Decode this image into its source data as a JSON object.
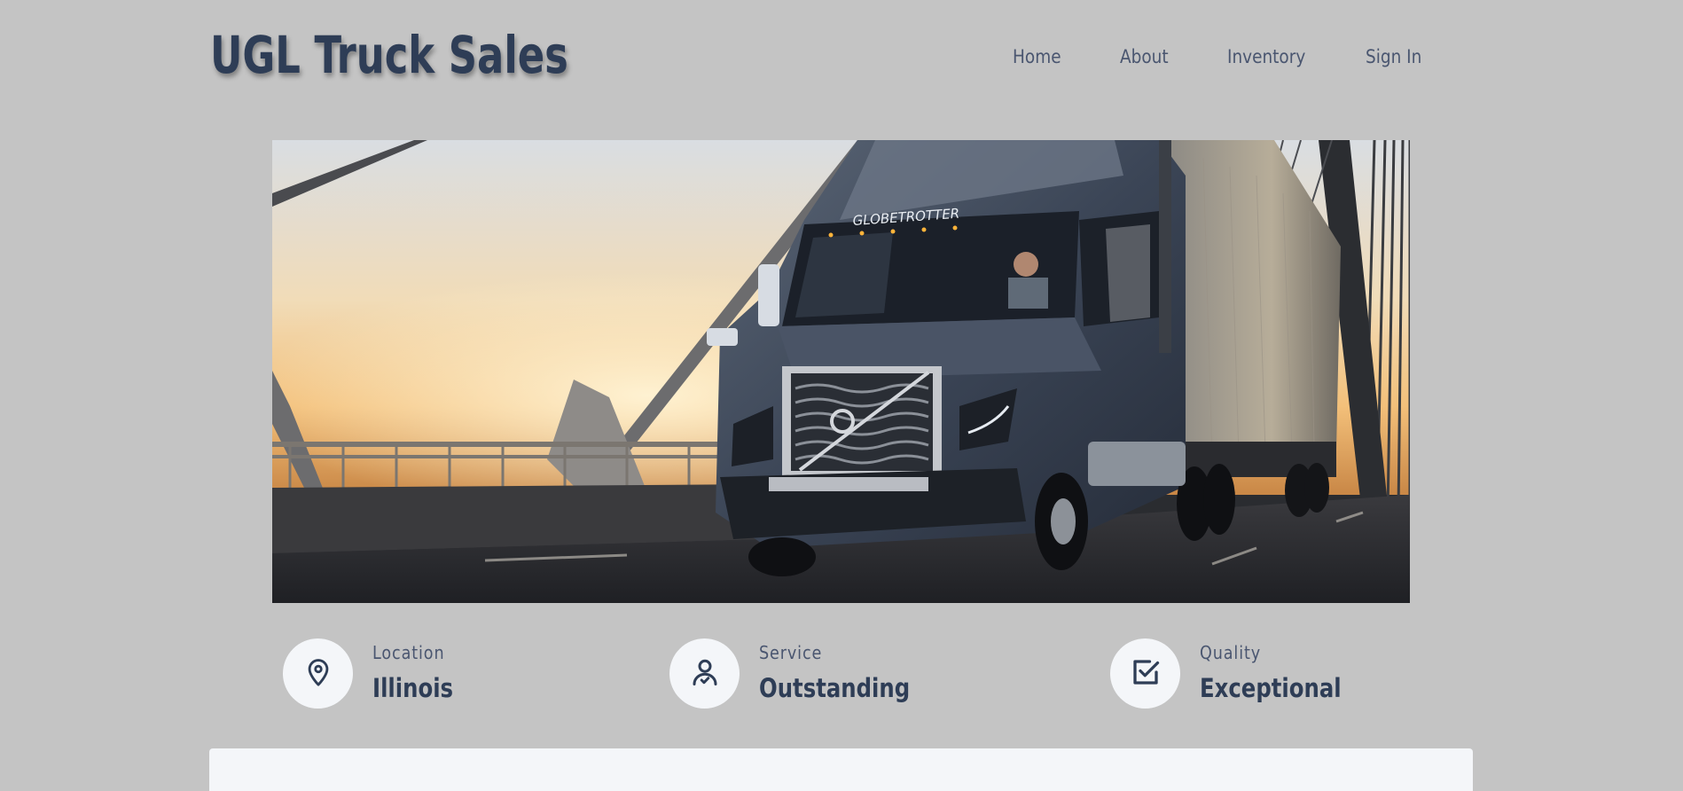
{
  "header": {
    "brand": "UGL Truck Sales",
    "nav": [
      {
        "label": "Home"
      },
      {
        "label": "About"
      },
      {
        "label": "Inventory"
      },
      {
        "label": "Sign In"
      }
    ]
  },
  "hero": {
    "truck_badge": "GLOBETROTTER"
  },
  "features": [
    {
      "label": "Location",
      "value": "Illinois",
      "icon": "location-pin-icon"
    },
    {
      "label": "Service",
      "value": "Outstanding",
      "icon": "user-service-icon"
    },
    {
      "label": "Quality",
      "value": "Exceptional",
      "icon": "checkbox-check-icon"
    }
  ],
  "colors": {
    "background": "#c4c4c4",
    "brand_text": "#2e3d56",
    "nav_text": "#4a5670",
    "icon_circle": "#f4f6f9",
    "card": "#f4f6f9"
  }
}
